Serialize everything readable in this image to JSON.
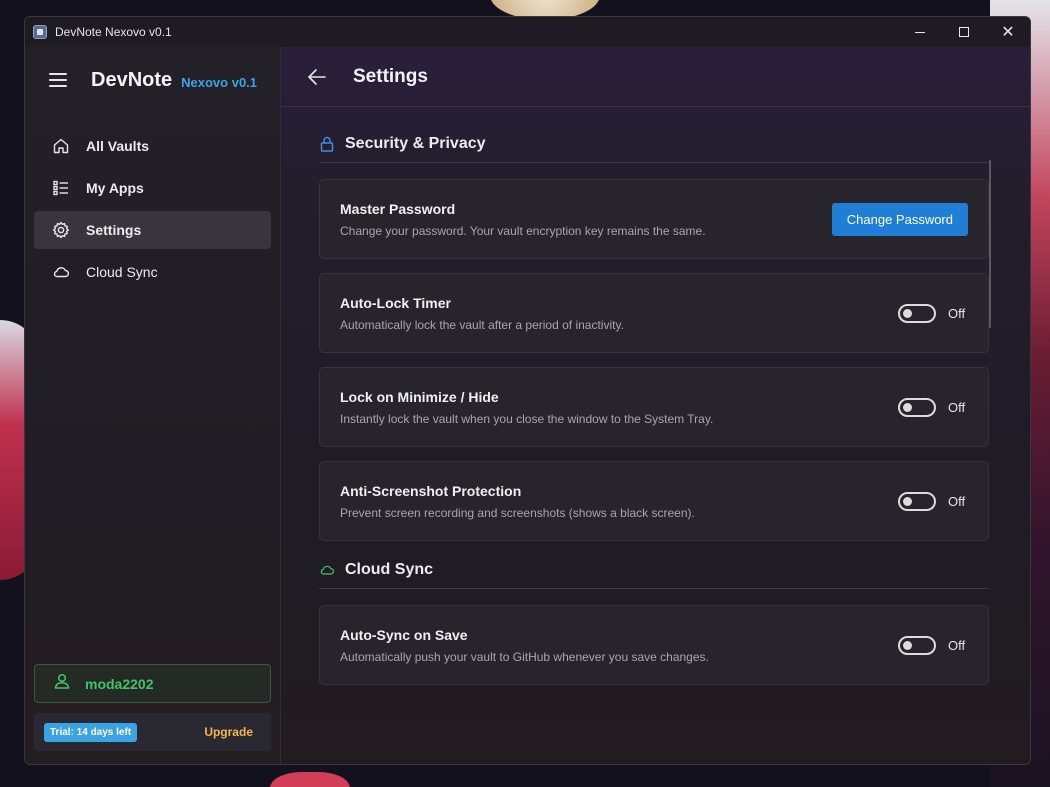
{
  "window": {
    "title": "DevNote Nexovo v0.1"
  },
  "sidebar": {
    "brand": "DevNote",
    "version": "Nexovo v0.1",
    "items": [
      {
        "label": "All Vaults",
        "icon": "home-icon"
      },
      {
        "label": "My Apps",
        "icon": "list-icon"
      },
      {
        "label": "Settings",
        "icon": "gear-icon",
        "active": true
      },
      {
        "label": "Cloud Sync",
        "icon": "cloud-icon"
      }
    ],
    "user": {
      "name": "moda2202"
    },
    "trial": {
      "badge": "Trial: 14 days left",
      "upgrade": "Upgrade"
    }
  },
  "header": {
    "title": "Settings"
  },
  "sections": {
    "security": {
      "title": "Security & Privacy",
      "master": {
        "title": "Master Password",
        "desc": "Change your password. Your vault encryption key remains the same.",
        "button": "Change Password"
      },
      "autolock": {
        "title": "Auto-Lock Timer",
        "desc": "Automatically lock the vault after a period of inactivity.",
        "state": "Off"
      },
      "minimize": {
        "title": "Lock on Minimize / Hide",
        "desc": "Instantly lock the vault when you close the window to the System Tray.",
        "state": "Off"
      },
      "screenshot": {
        "title": "Anti-Screenshot Protection",
        "desc": "Prevent screen recording and screenshots (shows a black screen).",
        "state": "Off"
      }
    },
    "cloud": {
      "title": "Cloud Sync",
      "autosync": {
        "title": "Auto-Sync on Save",
        "desc": "Automatically push your vault to GitHub whenever you save changes.",
        "state": "Off"
      }
    }
  },
  "colors": {
    "accent": "#1f7fd6",
    "brand_version": "#38a6e6",
    "user": "#45c26a",
    "upgrade": "#f2b84a",
    "lock_icon": "#3a8fe0",
    "cloud_icon": "#3fb46a"
  }
}
